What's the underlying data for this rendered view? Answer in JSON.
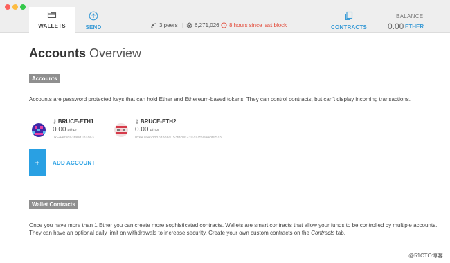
{
  "nav": {
    "wallets_label": "WALLETS",
    "send_label": "SEND",
    "contracts_label": "CONTRACTS"
  },
  "status": {
    "peers": "3 peers",
    "separator": "|",
    "block_number": "6,271,026",
    "last_block": "8 hours since last block"
  },
  "balance": {
    "label": "BALANCE",
    "value": "0.00",
    "unit": "ETHER"
  },
  "page": {
    "title_strong": "Accounts",
    "title_light": "Overview"
  },
  "accounts_section": {
    "heading": "Accounts",
    "description": "Accounts are password protected keys that can hold Ether and Ethereum-based tokens. They can control contracts, but can't display incoming transactions."
  },
  "accounts": [
    {
      "name": "BRUCE-ETH1",
      "balance": "0.00",
      "unit": "ether",
      "address": "0xF44b9d63fa0d1b1863..."
    },
    {
      "name": "BRUCE-ETH2",
      "balance": "0.00",
      "unit": "ether",
      "address": "0xe47a46b887d3869153fdc0623971759a448f6573"
    }
  ],
  "add_account": {
    "icon": "+",
    "label": "ADD ACCOUNT"
  },
  "wallet_section": {
    "heading": "Wallet Contracts",
    "description_line1": "Once you have more than 1 Ether you can create more sophisticated contracts. Wallets are smart contracts that allow your funds to be controlled by multiple accounts.",
    "description_line2_a": "They can have an optional daily limit on withdrawals to increase security. Create your own custom contracts on the ",
    "description_line2_em": "Contracts",
    "description_line2_b": " tab."
  },
  "watermark": "@51CTO博客",
  "colors": {
    "accent": "#29a0e3",
    "warning": "#e34b3a",
    "badge": "#8f8f8f"
  }
}
